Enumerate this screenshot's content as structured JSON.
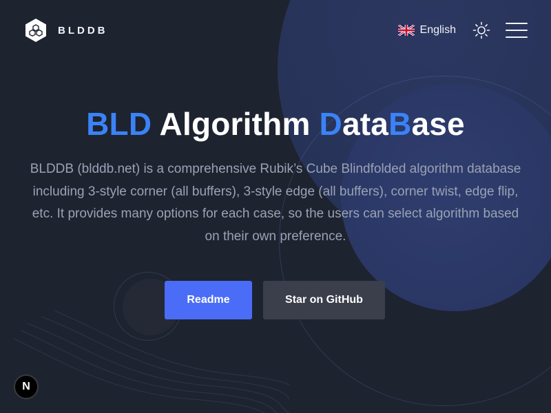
{
  "header": {
    "brand": "BLDDB",
    "language": "English",
    "icons": {
      "logo": "cube-hex-logo-icon",
      "flag": "uk-flag-icon",
      "theme": "sun-icon",
      "menu": "hamburger-menu-icon"
    }
  },
  "hero": {
    "title_parts": [
      "BLD",
      " Algorithm ",
      "D",
      "ata",
      "B",
      "ase"
    ],
    "description": "BLDDB (blddb.net) is a comprehensive Rubik’s Cube Blindfolded algorithm database including 3-style corner (all buffers), 3-style edge (all buffers), corner twist, edge flip, etc. It provides many options for each case, so the users can select algorithm based on their own preference.",
    "readme_label": "Readme",
    "github_label": "Star on GitHub"
  },
  "badge": {
    "label": "N",
    "icon": "nextjs-icon"
  },
  "colors": {
    "background": "#1e2330",
    "accent": "#3b82f6",
    "primary_button": "#4a6cf7",
    "secondary_button": "#3a3f4b",
    "description_text": "#9aa2b4"
  }
}
